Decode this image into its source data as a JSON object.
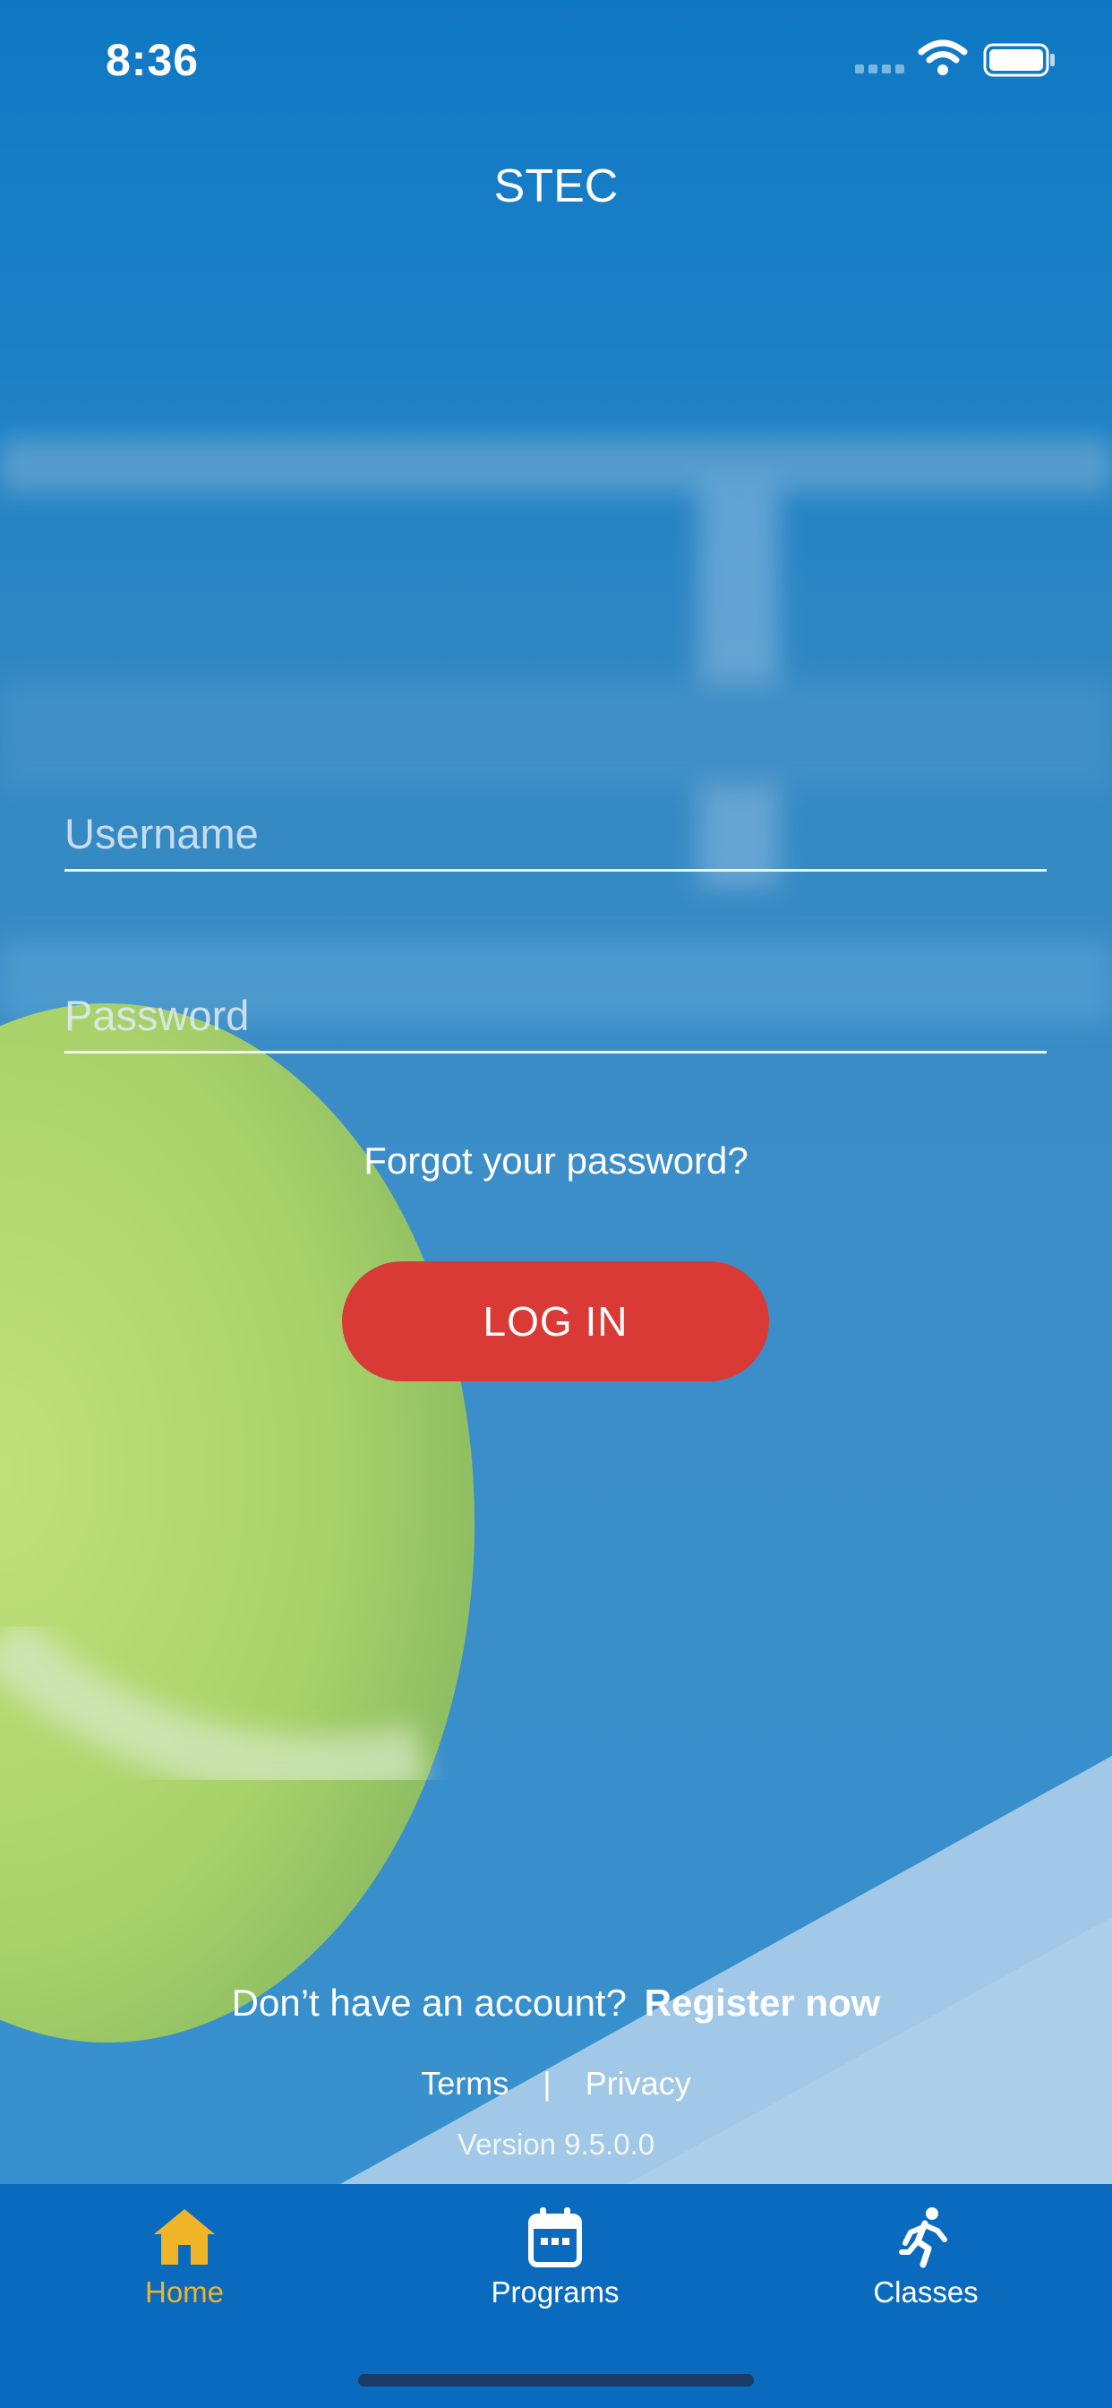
{
  "status_bar": {
    "time": "8:36"
  },
  "header": {
    "title": "STEC"
  },
  "login_form": {
    "username_placeholder": "Username",
    "password_placeholder": "Password",
    "forgot_password": "Forgot your password?",
    "login_button": "LOG IN"
  },
  "footer": {
    "register_prompt": "Don’t have an account?",
    "register_link": "Register now",
    "terms": "Terms",
    "separator": "|",
    "privacy": "Privacy",
    "version": "Version 9.5.0.0"
  },
  "tab_bar": {
    "tabs": [
      {
        "label": "Home",
        "icon": "home-icon",
        "active": true
      },
      {
        "label": "Programs",
        "icon": "calendar-icon",
        "active": false
      },
      {
        "label": "Classes",
        "icon": "running-person-icon",
        "active": false
      }
    ]
  },
  "colors": {
    "primary_blue": "#0a6bbe",
    "login_button": "#d93a35",
    "active_tab": "#f0b429",
    "ball_green": "#b5d96a"
  }
}
